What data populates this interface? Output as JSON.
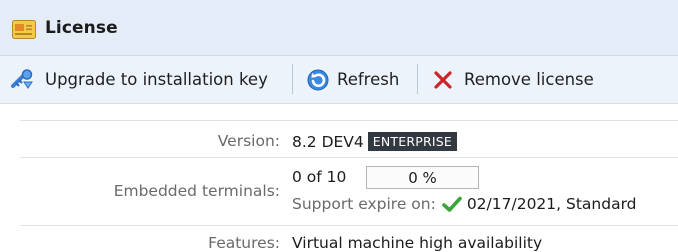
{
  "panel": {
    "title": "License",
    "icon": "license-card-icon"
  },
  "toolbar": {
    "upgrade_label": "Upgrade to installation key",
    "upgrade_icon": "key-upgrade-icon",
    "refresh_label": "Refresh",
    "refresh_icon": "refresh-icon",
    "remove_label": "Remove license",
    "remove_icon": "remove-x-icon"
  },
  "details": {
    "version": {
      "label": "Version:",
      "value": "8.2 DEV4",
      "edition": "ENTERPRISE"
    },
    "terminals": {
      "label": "Embedded terminals:",
      "count_text": "0 of 10",
      "progress_percent": 0,
      "progress_text": "0 %",
      "support_label": "Support expire on:",
      "support_icon": "checkmark-icon",
      "support_value": "02/17/2021, Standard"
    },
    "features": {
      "label": "Features:",
      "value": "Virtual machine high availability"
    }
  },
  "colors": {
    "titlebar_bg": "#e4ecf7",
    "toolbar_bg": "#edf3fb",
    "badge_bg": "#333940",
    "check_green": "#3aa53a",
    "remove_red": "#c8262b",
    "refresh_blue": "#2e7cd1"
  }
}
